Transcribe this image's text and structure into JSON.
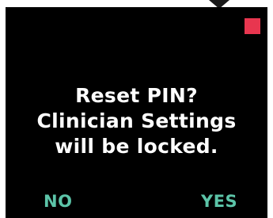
{
  "dialog": {
    "message_lines": [
      "Reset PIN?",
      "Clinician Settings",
      "will be locked."
    ],
    "no_label": "NO",
    "yes_label": "YES"
  },
  "icons": {
    "pointer": "down-arrow-pointer-icon",
    "status": "red-square-status-icon"
  },
  "colors": {
    "screen_background": "#000000",
    "text": "#ffffff",
    "softkey": "#5cc4a8",
    "status_indicator": "#e8364f"
  }
}
